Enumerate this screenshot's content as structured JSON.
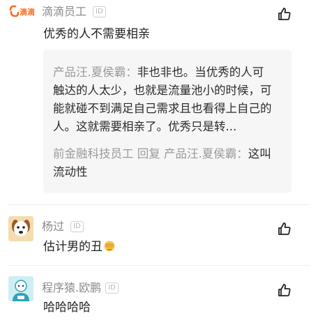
{
  "comments": [
    {
      "author_logo_text": "滴滴",
      "author": "滴滴员工",
      "id_badge": "ID",
      "text": "优秀的人不需要相亲",
      "reply_preview": {
        "r1_name": "产品汪.夏侯霸",
        "r1_sep": "：",
        "r1_line1": "非也非也。当优秀的人可",
        "r1_line2": "触达的人太少，也就是流量池小的时候，可",
        "r1_line3": "能就碰不到满足自己需求且也看得上自己的",
        "r1_line4": "人。这就需要相亲了。优秀只是转...",
        "r2_name": "前金融科技员工",
        "r2_reply_word": "回复",
        "r2_target": "产品汪.夏侯霸",
        "r2_sep": "：",
        "r2_line1": "这叫",
        "r2_line2": "流动性"
      }
    },
    {
      "author": "杨过",
      "id_badge": "ID",
      "text": "估计男的丑"
    },
    {
      "author": "程序猿.欧鹏",
      "id_badge": "ID",
      "text": "哈哈哈哈"
    }
  ],
  "colors": {
    "didi_orange": "#fc6a1c",
    "muted": "#9a9a9a"
  },
  "icons": {
    "like": "thumbs-up-icon",
    "avatar_1": "didi-logo",
    "avatar_2": "dog-avatar",
    "avatar_3": "cartoon-person-avatar",
    "emoji": "cover-face-emoji"
  }
}
